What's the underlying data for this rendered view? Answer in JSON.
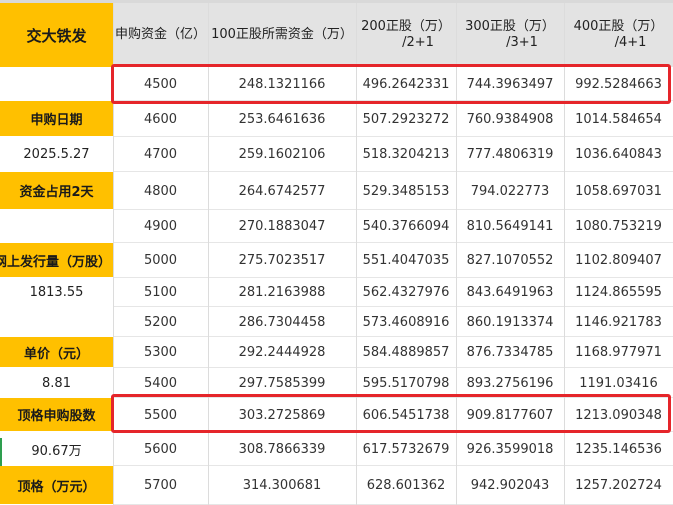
{
  "header": {
    "title": "交大铁发",
    "columns": [
      {
        "line1": "申购资金（亿）",
        "line2": ""
      },
      {
        "line1": "100正股所需资金（万）",
        "line2": ""
      },
      {
        "line1": "200正股（万）",
        "line2": "/2+1"
      },
      {
        "line1": "300正股（万）",
        "line2": "/3+1"
      },
      {
        "line1": "400正股（万）",
        "line2": "/4+1"
      }
    ]
  },
  "rows": [
    {
      "label": "",
      "label_style": "plain",
      "cells": [
        "4500",
        "248.1321166",
        "496.2642331",
        "744.3963497",
        "992.5284663"
      ]
    },
    {
      "label": "申购日期",
      "label_style": "yellow",
      "cells": [
        "4600",
        "253.6461636",
        "507.2923272",
        "760.9384908",
        "1014.584654"
      ]
    },
    {
      "label": "2025.5.27",
      "label_style": "plain",
      "cells": [
        "4700",
        "259.1602106",
        "518.3204213",
        "777.4806319",
        "1036.640843"
      ]
    },
    {
      "label": "资金占用2天",
      "label_style": "yellow",
      "cells": [
        "4800",
        "264.6742577",
        "529.3485153",
        "794.022773",
        "1058.697031"
      ]
    },
    {
      "label": "",
      "label_style": "plain",
      "cells": [
        "4900",
        "270.1883047",
        "540.3766094",
        "810.5649141",
        "1080.753219"
      ]
    },
    {
      "label": "网上发行量（万股）",
      "label_style": "yellow",
      "cells": [
        "5000",
        "275.7023517",
        "551.4047035",
        "827.1070552",
        "1102.809407"
      ]
    },
    {
      "label": "1813.55",
      "label_style": "plain",
      "cells": [
        "5100",
        "281.2163988",
        "562.4327976",
        "843.6491963",
        "1124.865595"
      ]
    },
    {
      "label": "",
      "label_style": "plain",
      "cells": [
        "5200",
        "286.7304458",
        "573.4608916",
        "860.1913374",
        "1146.921783"
      ]
    },
    {
      "label": "单价（元）",
      "label_style": "yellow",
      "cells": [
        "5300",
        "292.2444928",
        "584.4889857",
        "876.7334785",
        "1168.977971"
      ]
    },
    {
      "label": "8.81",
      "label_style": "plain",
      "cells": [
        "5400",
        "297.7585399",
        "595.5170798",
        "893.2756196",
        "1191.03416"
      ]
    },
    {
      "label": "顶格申购股数",
      "label_style": "yellow",
      "cells": [
        "5500",
        "303.2725869",
        "606.5451738",
        "909.8177607",
        "1213.090348"
      ]
    },
    {
      "label": "90.67万",
      "label_style": "plain",
      "cells": [
        "5600",
        "308.7866339",
        "617.5732679",
        "926.3599018",
        "1235.146536"
      ]
    },
    {
      "label": "顶格（万元）",
      "label_style": "yellow",
      "cells": [
        "5700",
        "314.300681",
        "628.601362",
        "942.902043",
        "1257.202724"
      ]
    }
  ],
  "highlights": [
    "4500",
    "5500"
  ],
  "colors": {
    "label_fill": "#ffc000",
    "header_fill": "#e3e3e3",
    "highlight_border": "#e5252a"
  }
}
